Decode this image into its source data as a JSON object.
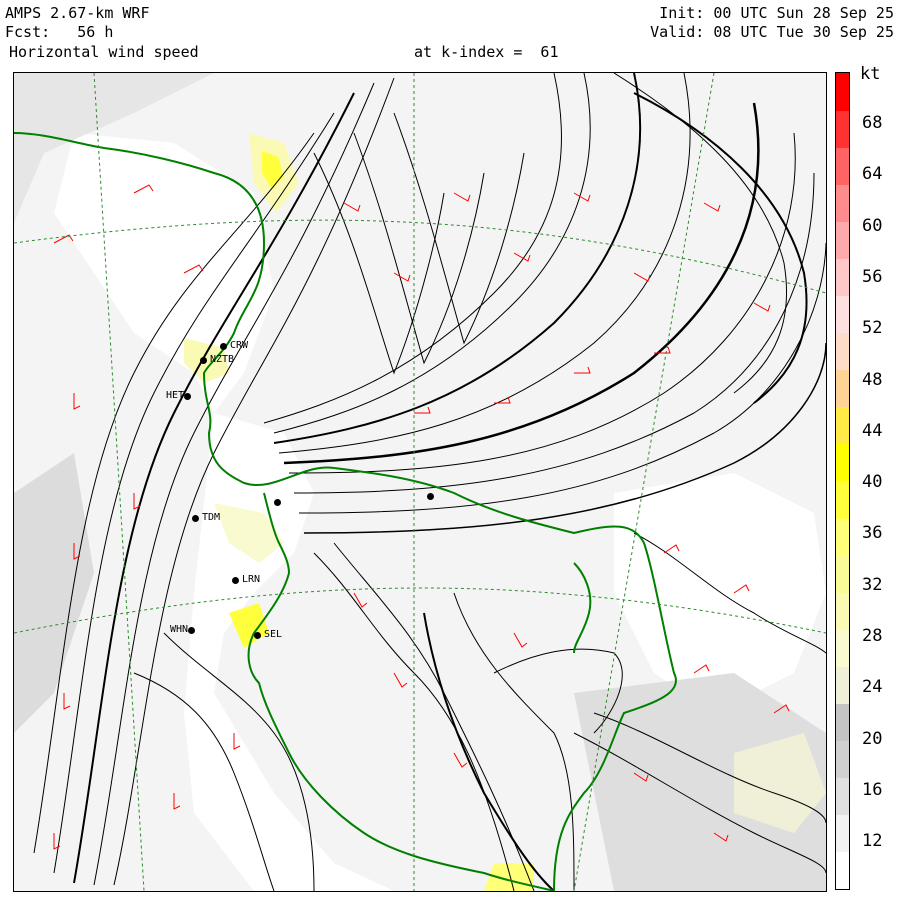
{
  "header": {
    "model": "AMPS 2.67-km WRF",
    "forecast": "Fcst:   56 h",
    "field": "Horizontal wind speed",
    "init": "Init: 00 UTC Sun 28 Sep 25",
    "valid": "Valid: 08 UTC Tue 30 Sep 25",
    "level": "at k-index =  61"
  },
  "colorbar": {
    "unit": "kt",
    "ticks": [
      "68",
      "64",
      "60",
      "56",
      "52",
      "48",
      "44",
      "40",
      "36",
      "32",
      "28",
      "24",
      "20",
      "16",
      "12"
    ],
    "colors": [
      "#ffffff",
      "#f2f2f2",
      "#e0e0e0",
      "#d0d0d0",
      "#c4c4c4",
      "#f0f0d8",
      "#fafad0",
      "#fafab4",
      "#fafa96",
      "#ffff78",
      "#ffff3c",
      "#ffff00",
      "#ffea46",
      "#ffd296",
      "#ffdcc8",
      "#ffe0e0",
      "#ffc8c8",
      "#ffaaaa",
      "#ff8c8c",
      "#ff6464",
      "#ff3232",
      "#ff0000"
    ]
  },
  "stations": [
    {
      "name": "CRW"
    },
    {
      "name": "NZTB"
    },
    {
      "name": "HET"
    },
    {
      "name": "TDM"
    },
    {
      "name": "LRN"
    },
    {
      "name": "WHN"
    },
    {
      "name": "SEL"
    },
    {
      "name": ""
    },
    {
      "name": ""
    }
  ],
  "map_colors": {
    "background": "#f4f4f4",
    "terrain": "#ffffff",
    "streamline": "#000000",
    "barb": "#ff0000",
    "coast": "#008000",
    "grid": "#2e8b2e"
  }
}
